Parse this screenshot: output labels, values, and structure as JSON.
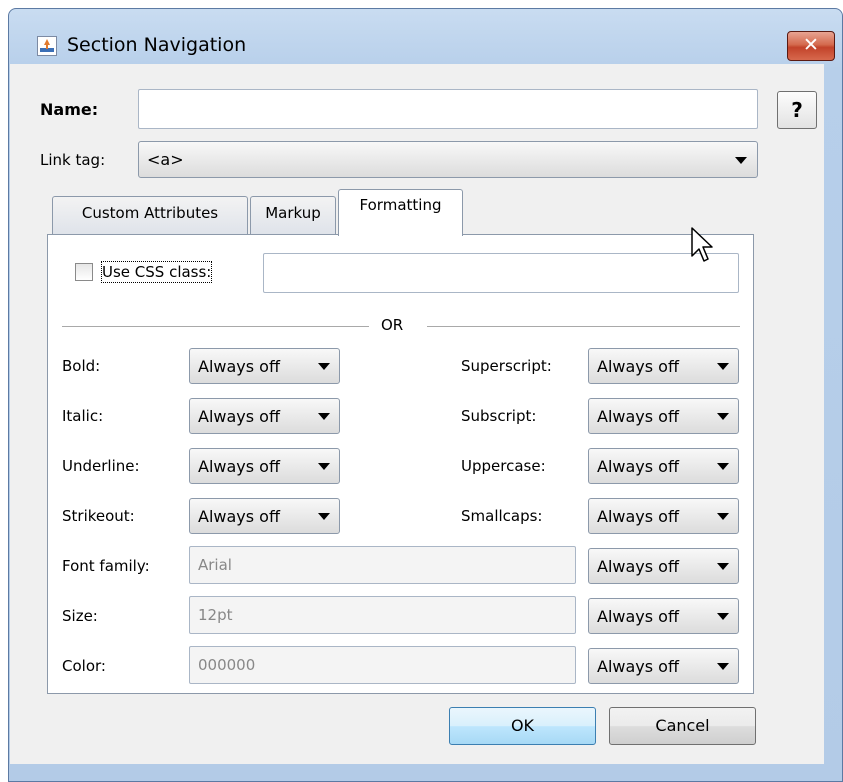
{
  "window": {
    "title": "Section Navigation",
    "close_label": "✕"
  },
  "form": {
    "name_label": "Name:",
    "name_value": "",
    "help_label": "?",
    "link_tag_label": "Link tag:",
    "link_tag_value": "<a>"
  },
  "tabs": [
    {
      "label": "Custom Attributes"
    },
    {
      "label": "Markup"
    },
    {
      "label": "Formatting"
    }
  ],
  "formatting": {
    "use_css_label": "Use CSS class:",
    "css_class_value": "",
    "or_label": "OR",
    "left_rows": [
      {
        "label": "Bold:",
        "value": "Always off"
      },
      {
        "label": "Italic:",
        "value": "Always off"
      },
      {
        "label": "Underline:",
        "value": "Always off"
      },
      {
        "label": "Strikeout:",
        "value": "Always off"
      }
    ],
    "right_rows": [
      {
        "label": "Superscript:",
        "value": "Always off"
      },
      {
        "label": "Subscript:",
        "value": "Always off"
      },
      {
        "label": "Uppercase:",
        "value": "Always off"
      },
      {
        "label": "Smallcaps:",
        "value": "Always off"
      }
    ],
    "font_family_label": "Font family:",
    "font_family_value": "Arial",
    "font_family_mode": "Always off",
    "size_label": "Size:",
    "size_value": "12pt",
    "size_mode": "Always off",
    "color_label": "Color:",
    "color_value": "000000",
    "color_mode": "Always off"
  },
  "buttons": {
    "ok": "OK",
    "cancel": "Cancel"
  }
}
